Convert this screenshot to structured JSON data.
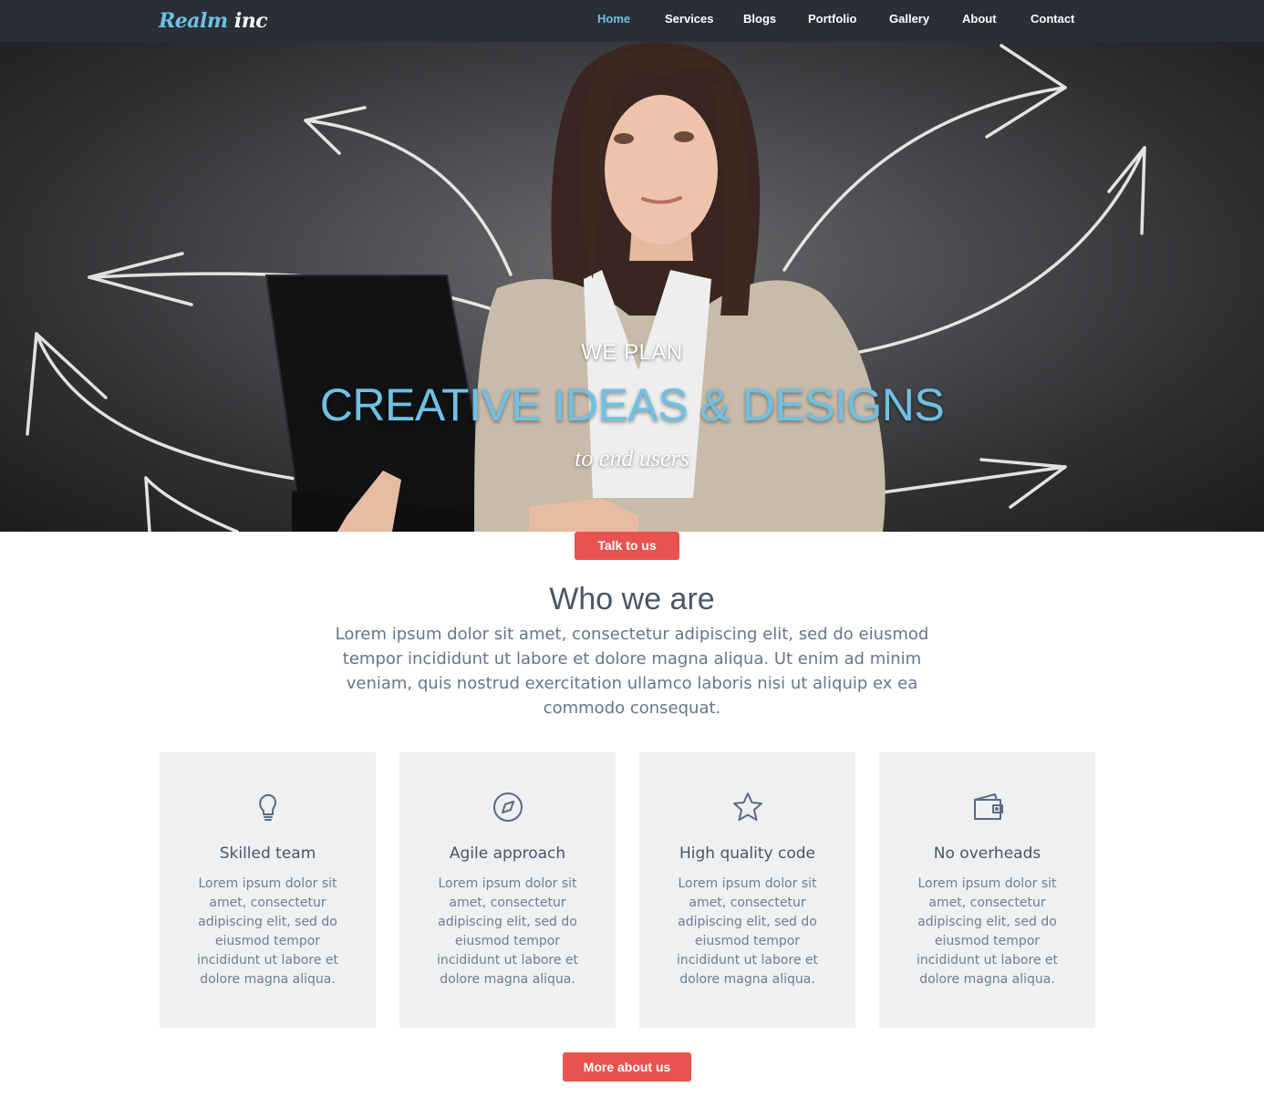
{
  "brand": {
    "name_part1": "Realm",
    "name_part2": "inc"
  },
  "nav": {
    "items": [
      {
        "label": "Home",
        "active": true
      },
      {
        "label": "Services",
        "active": false
      },
      {
        "label": "Blogs",
        "active": false
      },
      {
        "label": "Portfolio",
        "active": false
      },
      {
        "label": "Gallery",
        "active": false
      },
      {
        "label": "About",
        "active": false
      },
      {
        "label": "Contact",
        "active": false
      }
    ]
  },
  "hero": {
    "kicker": "WE PLAN",
    "title": "CREATIVE IDEAS & DESIGNS",
    "subtitle": "to end users",
    "cta_label": "Talk to us"
  },
  "about": {
    "title": "Who we are",
    "text": "Lorem ipsum dolor sit amet, consectetur adipiscing elit, sed do eiusmod tempor incididunt ut labore et dolore magna aliqua. Ut enim ad minim veniam, quis nostrud exercitation ullamco laboris nisi ut aliquip ex ea commodo consequat.",
    "more_label": "More about us"
  },
  "features": [
    {
      "icon": "lightbulb-icon",
      "title": "Skilled team",
      "text": "Lorem ipsum dolor sit amet, consectetur adipiscing elit, sed do eiusmod tempor incididunt ut labore et dolore magna aliqua."
    },
    {
      "icon": "compass-icon",
      "title": "Agile approach",
      "text": "Lorem ipsum dolor sit amet, consectetur adipiscing elit, sed do eiusmod tempor incididunt ut labore et dolore magna aliqua."
    },
    {
      "icon": "star-icon",
      "title": "High quality code",
      "text": "Lorem ipsum dolor sit amet, consectetur adipiscing elit, sed do eiusmod tempor incididunt ut labore et dolore magna aliqua."
    },
    {
      "icon": "wallet-icon",
      "title": "No overheads",
      "text": "Lorem ipsum dolor sit amet, consectetur adipiscing elit, sed do eiusmod tempor incididunt ut labore et dolore magna aliqua."
    }
  ],
  "colors": {
    "navbar_bg": "#2a2e36",
    "accent_blue": "#6ec1e4",
    "button_red": "#e9534f",
    "card_bg": "#eef0f2",
    "heading_text": "#4a5568"
  }
}
